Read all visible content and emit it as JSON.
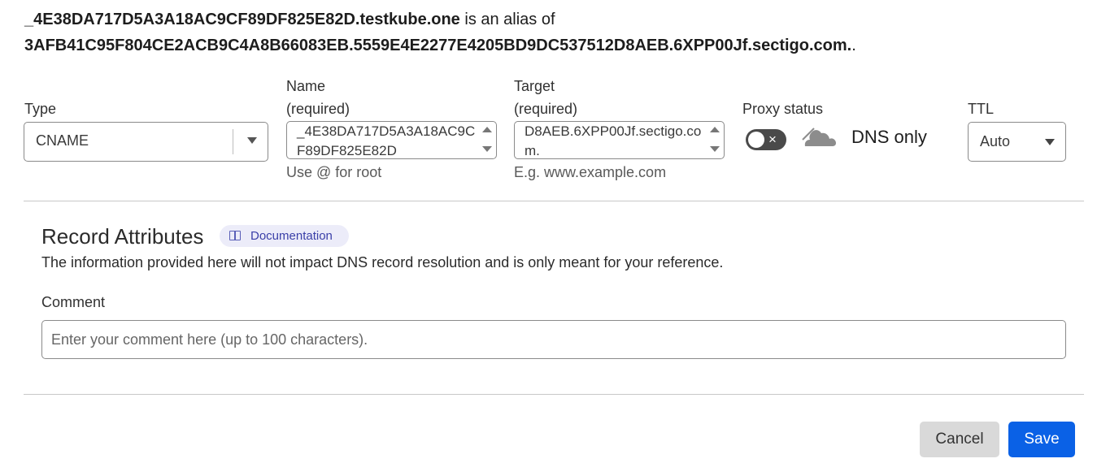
{
  "summary": {
    "alias_name": "_4E38DA717D5A3A18AC9CF89DF825E82D.testkube.one",
    "alias_text": " is an alias of ",
    "target": "3AFB41C95F804CE2ACB9C4A8B66083EB.5559E4E2277E4205BD9DC537512D8AEB.6XPP00Jf.sectigo.com.",
    "trailing": "."
  },
  "form": {
    "type": {
      "label": "Type",
      "value": "CNAME"
    },
    "name": {
      "label": "Name",
      "required": "(required)",
      "value": "_4E38DA717D5A3A18AC9CF89DF825E82D",
      "hint": "Use @ for root"
    },
    "target": {
      "label": "Target",
      "required": "(required)",
      "value": "D8AEB.6XPP00Jf.sectigo.com.",
      "hint": "E.g. www.example.com"
    },
    "proxy": {
      "label": "Proxy status",
      "toggle_icon": "×",
      "status": "DNS only",
      "enabled": false
    },
    "ttl": {
      "label": "TTL",
      "value": "Auto"
    }
  },
  "record_attributes": {
    "title": "Record Attributes",
    "doc_badge": "Documentation",
    "description": "The information provided here will not impact DNS record resolution and is only meant for your reference.",
    "comment_label": "Comment",
    "comment_placeholder": "Enter your comment here (up to 100 characters).",
    "comment_value": ""
  },
  "actions": {
    "cancel": "Cancel",
    "save": "Save"
  },
  "colors": {
    "primary": "#0a61e6",
    "cancel_bg": "#d9d9d9",
    "badge_bg": "#ececf9",
    "toggle_bg": "#4a4a4a"
  }
}
